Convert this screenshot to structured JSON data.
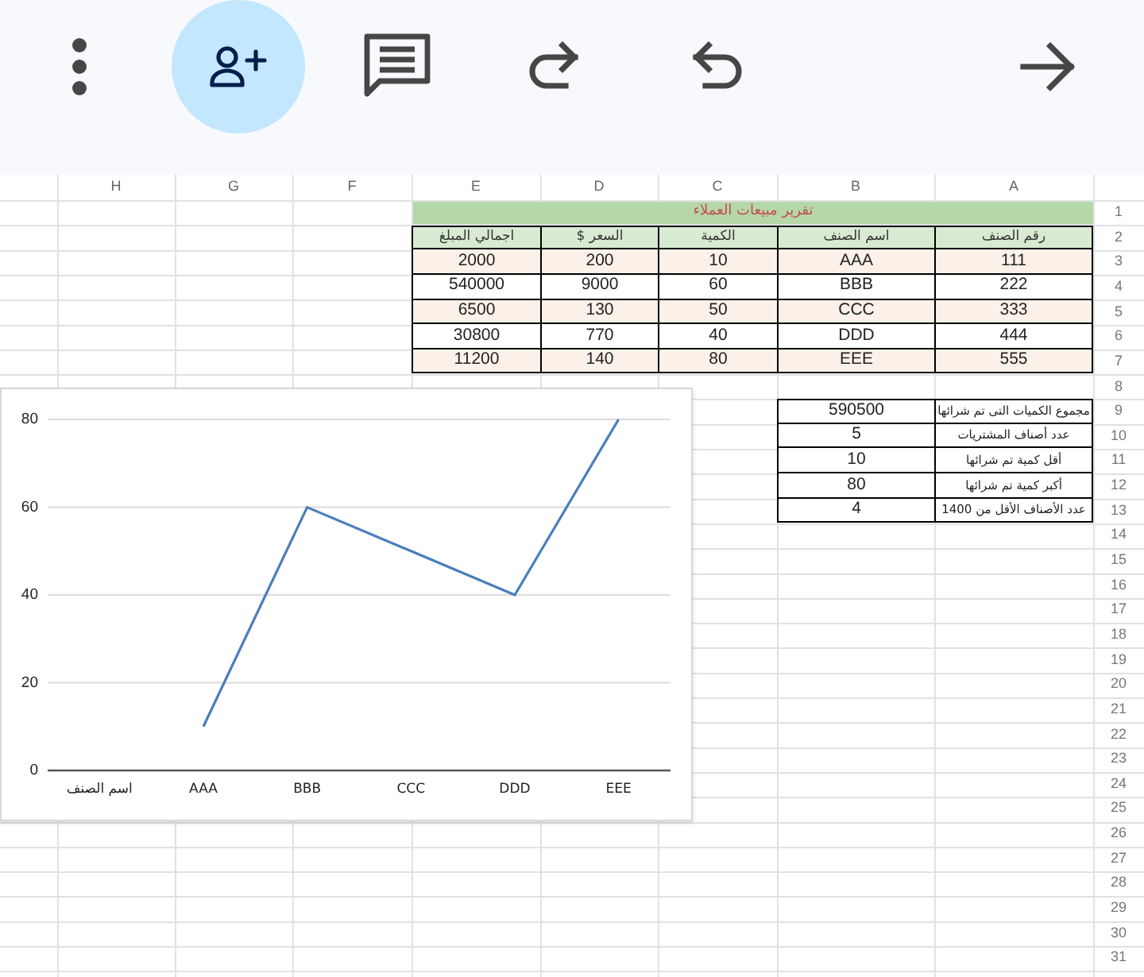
{
  "toolbar": {
    "buttons": [
      {
        "kind": "more",
        "active": false
      },
      {
        "kind": "add_person",
        "active": true
      },
      {
        "kind": "comment",
        "active": false
      },
      {
        "kind": "redo",
        "active": false
      },
      {
        "kind": "undo",
        "active": false
      },
      {
        "kind": "forward",
        "active": false
      }
    ]
  },
  "sheet": {
    "columns": [
      "A",
      "B",
      "C",
      "D",
      "E",
      "F",
      "G",
      "H"
    ],
    "row_numbers": [
      "1",
      "2",
      "3",
      "4",
      "5",
      "6",
      "7",
      "8",
      "9",
      "10",
      "11",
      "12",
      "13",
      "14",
      "15",
      "16",
      "17",
      "18",
      "19",
      "20",
      "21",
      "22",
      "23",
      "24",
      "25",
      "26",
      "27",
      "28",
      "29",
      "30",
      "31"
    ],
    "report": {
      "title": "تقرير مبيعات العملاء",
      "headers": [
        "رقم الصنف",
        "اسم الصنف",
        "الكمية",
        "السعر $",
        "اجمالي المبلغ"
      ],
      "rows": [
        [
          "111",
          "AAA",
          "10",
          "200",
          "2000"
        ],
        [
          "222",
          "BBB",
          "60",
          "9000",
          "540000"
        ],
        [
          "333",
          "CCC",
          "50",
          "130",
          "6500"
        ],
        [
          "444",
          "DDD",
          "40",
          "770",
          "30800"
        ],
        [
          "555",
          "EEE",
          "80",
          "140",
          "11200"
        ]
      ]
    },
    "summary": [
      {
        "label": "مجموع الكميات التى تم شرائها",
        "value": "590500"
      },
      {
        "label": "عدد أصناف المشتريات",
        "value": "5"
      },
      {
        "label": "أقل كمية تم شرائها",
        "value": "10"
      },
      {
        "label": "أكبر كمية تم شرائها",
        "value": "80"
      },
      {
        "label": "عدد الأصناف الأقل من 1400",
        "value": "4"
      }
    ],
    "chart": {
      "chart_data": {
        "type": "line",
        "categories": [
          "اسم الصنف",
          "AAA",
          "BBB",
          "CCC",
          "DDD",
          "EEE"
        ],
        "values": [
          null,
          10,
          60,
          50,
          40,
          80
        ],
        "ylim": [
          0,
          80
        ],
        "yticks": [
          0,
          20,
          40,
          60,
          80
        ],
        "grid": true
      }
    }
  }
}
